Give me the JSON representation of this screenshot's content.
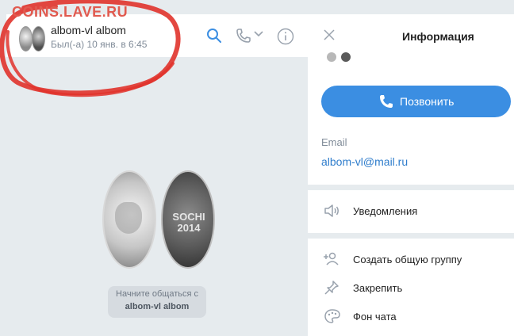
{
  "watermark": "COINS.LAVE.RU",
  "chat": {
    "contact_name": "albom-vl albom",
    "status": "Был(-а) 10 янв. в 6:45",
    "icons": [
      "search-icon",
      "phone-icon",
      "chevron-down-icon",
      "info-icon"
    ],
    "greeting_line1": "Начните общаться с",
    "greeting_line2": "albom-vl albom",
    "coin_text": "SOCHI 2014"
  },
  "info_panel": {
    "title": "Информация",
    "call_label": "Позвонить",
    "email_label": "Email",
    "email_value": "albom-vl@mail.ru",
    "menu": [
      {
        "label": "Уведомления",
        "icon": "speaker-icon"
      },
      {
        "label": "Создать общую группу",
        "icon": "add-user-icon"
      },
      {
        "label": "Закрепить",
        "icon": "pin-icon"
      },
      {
        "label": "Фон чата",
        "icon": "palette-icon"
      }
    ]
  },
  "colors": {
    "accent": "#3b8ee2",
    "link": "#2f7dcc",
    "background": "#e6ebee",
    "scribble": "#e0332b"
  }
}
